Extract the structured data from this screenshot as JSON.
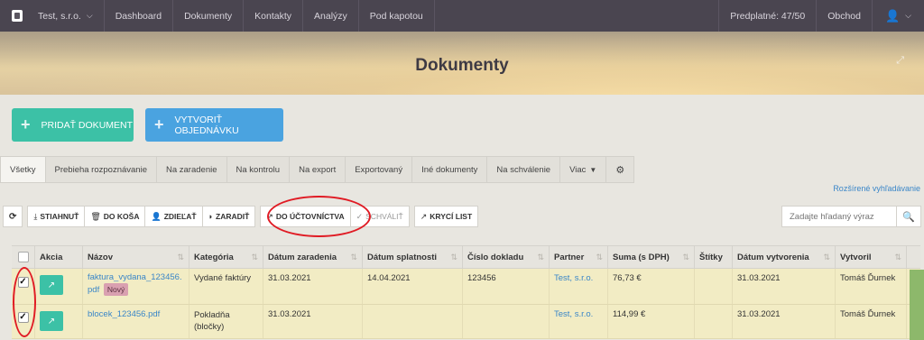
{
  "topnav": {
    "company": "Test, s.r.o.",
    "items": [
      "Dashboard",
      "Dokumenty",
      "Kontakty",
      "Analýzy",
      "Pod kapotou"
    ],
    "subscription": "Predplatné: 47/50",
    "shop": "Obchod"
  },
  "hero": {
    "title": "Dokumenty"
  },
  "actions": {
    "add_document": "PRIDAŤ DOKUMENT",
    "create_order": "VYTVORIŤ OBJEDNÁVKU"
  },
  "tabs": [
    "Všetky",
    "Prebieha rozpoznávanie",
    "Na zaradenie",
    "Na kontrolu",
    "Na export",
    "Exportovaný",
    "Iné dokumenty",
    "Na schválenie",
    "Viac"
  ],
  "advanced_search": "Rozšírené vyhľadávanie",
  "toolbar": {
    "download": "STIAHNUŤ",
    "trash": "DO KOŠA",
    "share": "ZDIEĽAŤ",
    "file": "ZARADIŤ",
    "to_accounting": "DO ÚČTOVNÍCTVA",
    "approve": "SCHVÁLIŤ",
    "cover_sheet": "KRYCÍ LIST"
  },
  "search": {
    "placeholder": "Zadajte hľadaný výraz"
  },
  "table": {
    "headers": [
      "Akcia",
      "Názov",
      "Kategória",
      "Dátum zaradenia",
      "Dátum splatnosti",
      "Číslo dokladu",
      "Partner",
      "Suma (s DPH)",
      "Štítky",
      "Dátum vytvorenia",
      "Vytvoril"
    ],
    "rows": [
      {
        "name": "faktura_vydana_123456.pdf",
        "badge": "Nový",
        "category": "Vydané faktúry",
        "date_filed": "31.03.2021",
        "due_date": "14.04.2021",
        "doc_number": "123456",
        "partner": "Test, s.r.o.",
        "amount": "76,73 €",
        "tags": "",
        "created": "31.03.2021",
        "created_by": "Tomáš Ďurnek"
      },
      {
        "name": "blocek_123456.pdf",
        "badge": "",
        "category": "Pokladňa (bločky)",
        "date_filed": "31.03.2021",
        "due_date": "",
        "doc_number": "",
        "partner": "Test, s.r.o.",
        "amount": "114,99 €",
        "tags": "",
        "created": "31.03.2021",
        "created_by": "Tomáš Ďurnek"
      }
    ]
  },
  "colors": {
    "nav_bg": "#4a4550",
    "green": "#3cc1a6",
    "blue": "#4aa3e0",
    "row_highlight": "#f2ecc4",
    "annotation_red": "#e01b24"
  }
}
